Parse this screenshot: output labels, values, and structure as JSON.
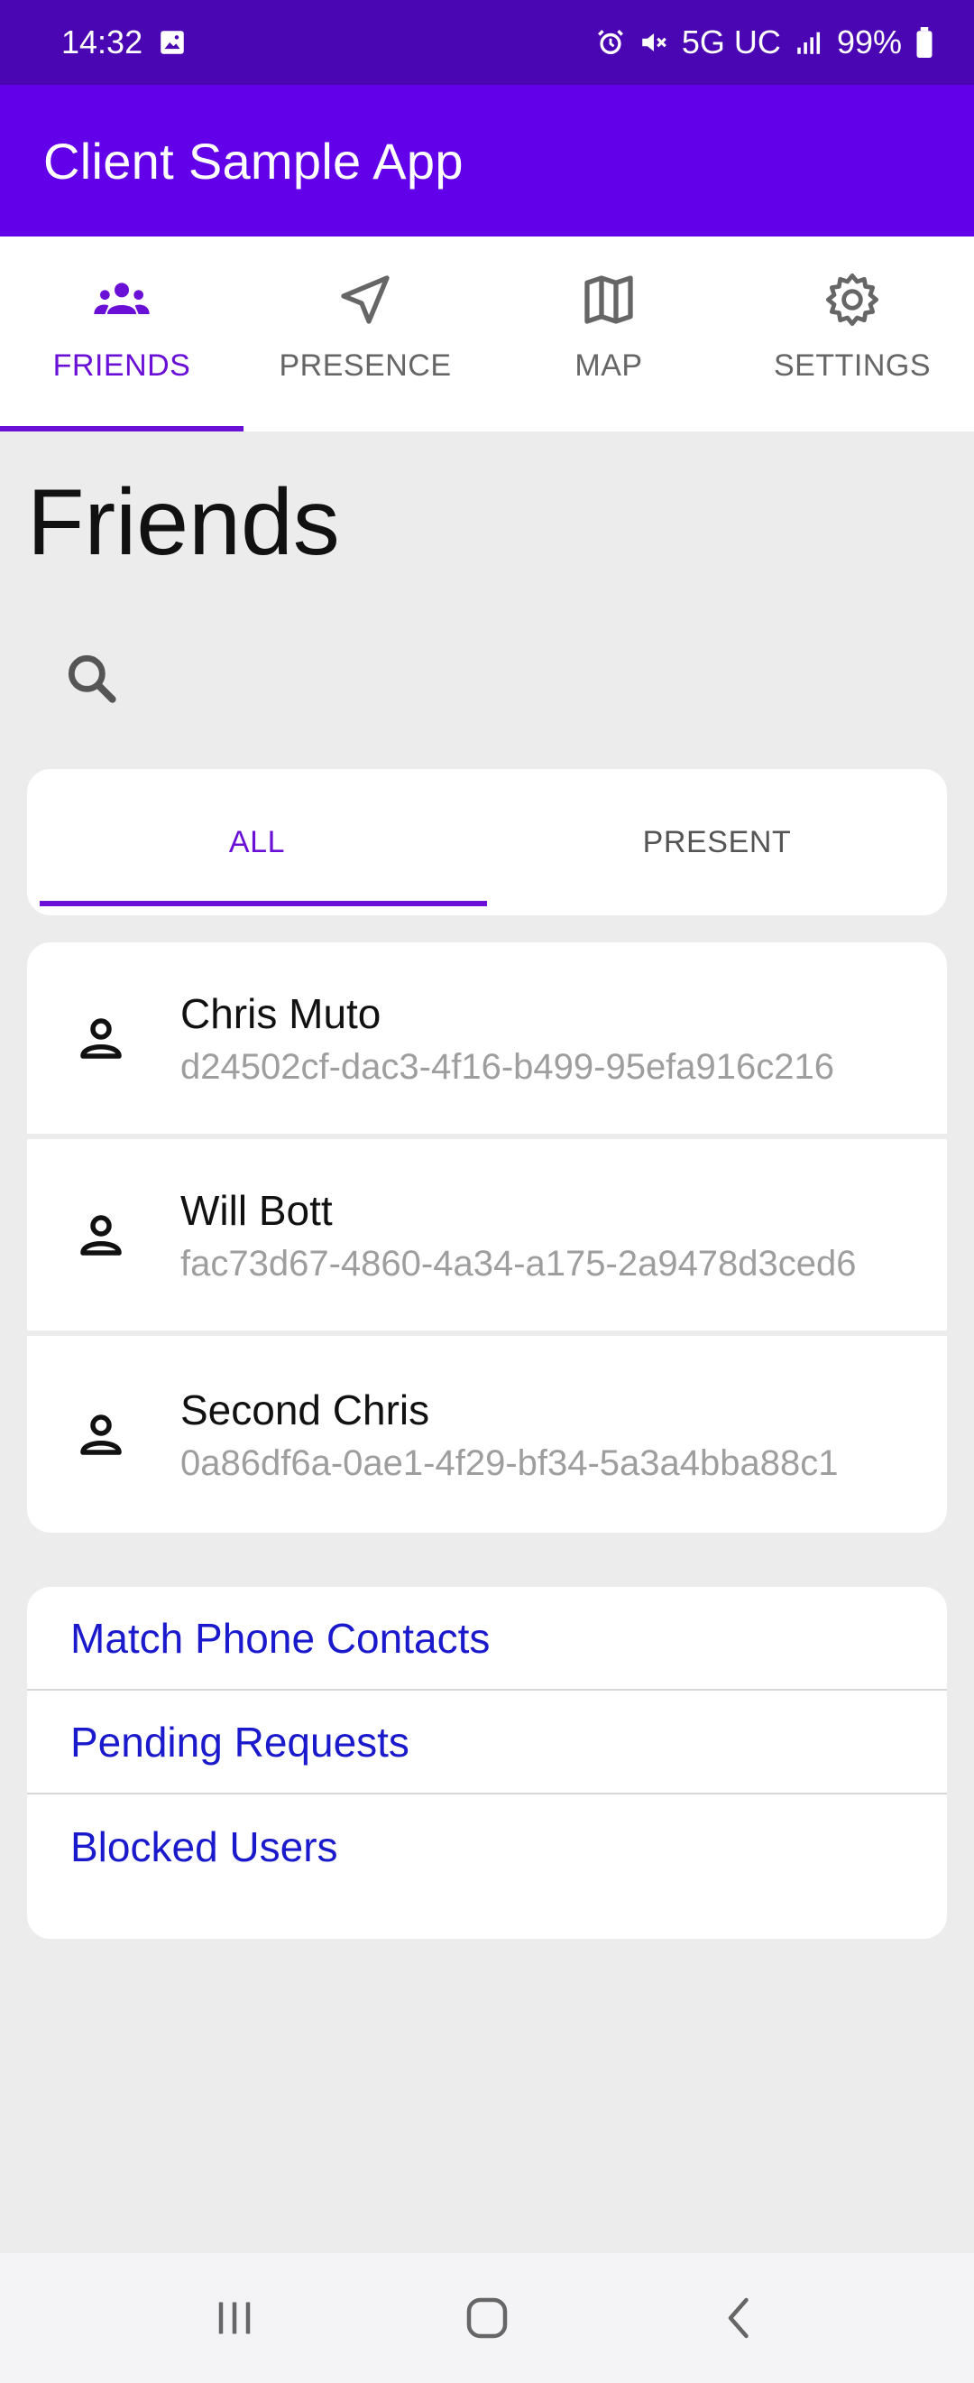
{
  "status_bar": {
    "time": "14:32",
    "network": "5G UC",
    "battery": "99%",
    "icons": [
      "image-icon",
      "alarm-icon",
      "mute-icon",
      "signal-icon",
      "battery-icon"
    ]
  },
  "app": {
    "title": "Client Sample App"
  },
  "top_tabs": [
    {
      "label": "FRIENDS",
      "icon": "people-icon",
      "active": true
    },
    {
      "label": "PRESENCE",
      "icon": "navigation-icon",
      "active": false
    },
    {
      "label": "MAP",
      "icon": "map-icon",
      "active": false
    },
    {
      "label": "SETTINGS",
      "icon": "gear-icon",
      "active": false
    }
  ],
  "page": {
    "title": "Friends"
  },
  "segments": [
    {
      "label": "ALL",
      "active": true
    },
    {
      "label": "PRESENT",
      "active": false
    }
  ],
  "friends": [
    {
      "name": "Chris Muto",
      "id": "d24502cf-dac3-4f16-b499-95efa916c216"
    },
    {
      "name": "Will Bott",
      "id": "fac73d67-4860-4a34-a175-2a9478d3ced6"
    },
    {
      "name": "Second Chris",
      "id": "0a86df6a-0ae1-4f29-bf34-5a3a4bba88c1"
    }
  ],
  "links": [
    {
      "label": "Match Phone Contacts"
    },
    {
      "label": "Pending Requests"
    },
    {
      "label": "Blocked Users"
    }
  ],
  "colors": {
    "status_bar": "#4a06b3",
    "app_bar": "#6200ea",
    "accent": "#6a0fd6",
    "link": "#1a1acc",
    "background": "#ececec"
  }
}
